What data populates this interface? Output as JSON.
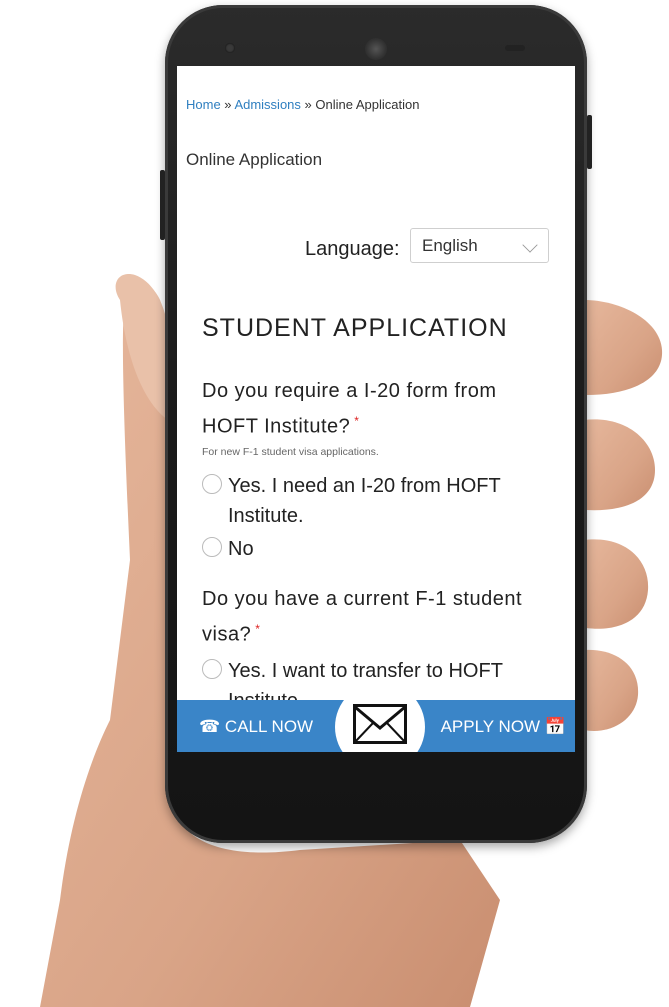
{
  "breadcrumb": {
    "home": "Home",
    "sep1": " » ",
    "admissions": "Admissions",
    "sep2": " » ",
    "current": "Online Application"
  },
  "page_heading": "Online Application",
  "language": {
    "label": "Language:",
    "selected": "English"
  },
  "form": {
    "title": "STUDENT APPLICATION",
    "questions": [
      {
        "text": "Do you require a I-20 form from HOFT Institute?",
        "required_mark": "*",
        "help": "For new F-1 student visa applications.",
        "options": [
          "Yes. I need an I-20 from HOFT Institute.",
          "No"
        ]
      },
      {
        "text": "Do you have a current F-1 student visa?",
        "required_mark": "*",
        "options": [
          "Yes. I want to transfer to HOFT Institute."
        ]
      }
    ]
  },
  "bottom_bar": {
    "call": "CALL NOW",
    "apply": "APPLY NOW"
  },
  "colors": {
    "link": "#2f7fc0",
    "bar": "#3a85c8",
    "required": "#d22222"
  }
}
